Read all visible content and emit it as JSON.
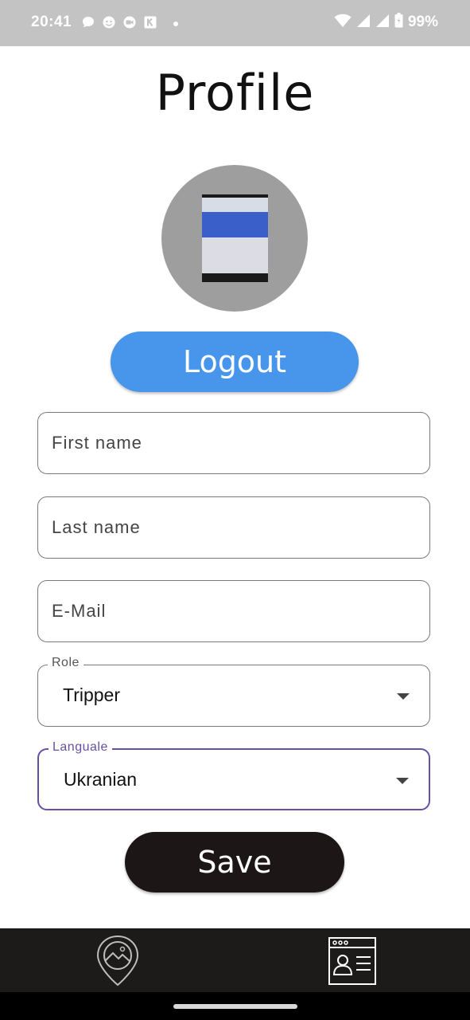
{
  "status_bar": {
    "time": "20:41",
    "battery": "99%"
  },
  "page": {
    "title": "Profile"
  },
  "actions": {
    "logout_label": "Logout",
    "save_label": "Save"
  },
  "form": {
    "first_name_placeholder": "First name",
    "last_name_placeholder": "Last name",
    "email_placeholder": "E-Mail",
    "role_label": "Role",
    "role_value": "Tripper",
    "language_label": "Languale",
    "language_value": "Ukranian"
  },
  "bottom_nav": {
    "items": [
      "map-pin-icon",
      "profile-card-icon"
    ]
  },
  "colors": {
    "logout": "#4895ec",
    "save": "#1d1616",
    "focus": "#6750a4"
  }
}
